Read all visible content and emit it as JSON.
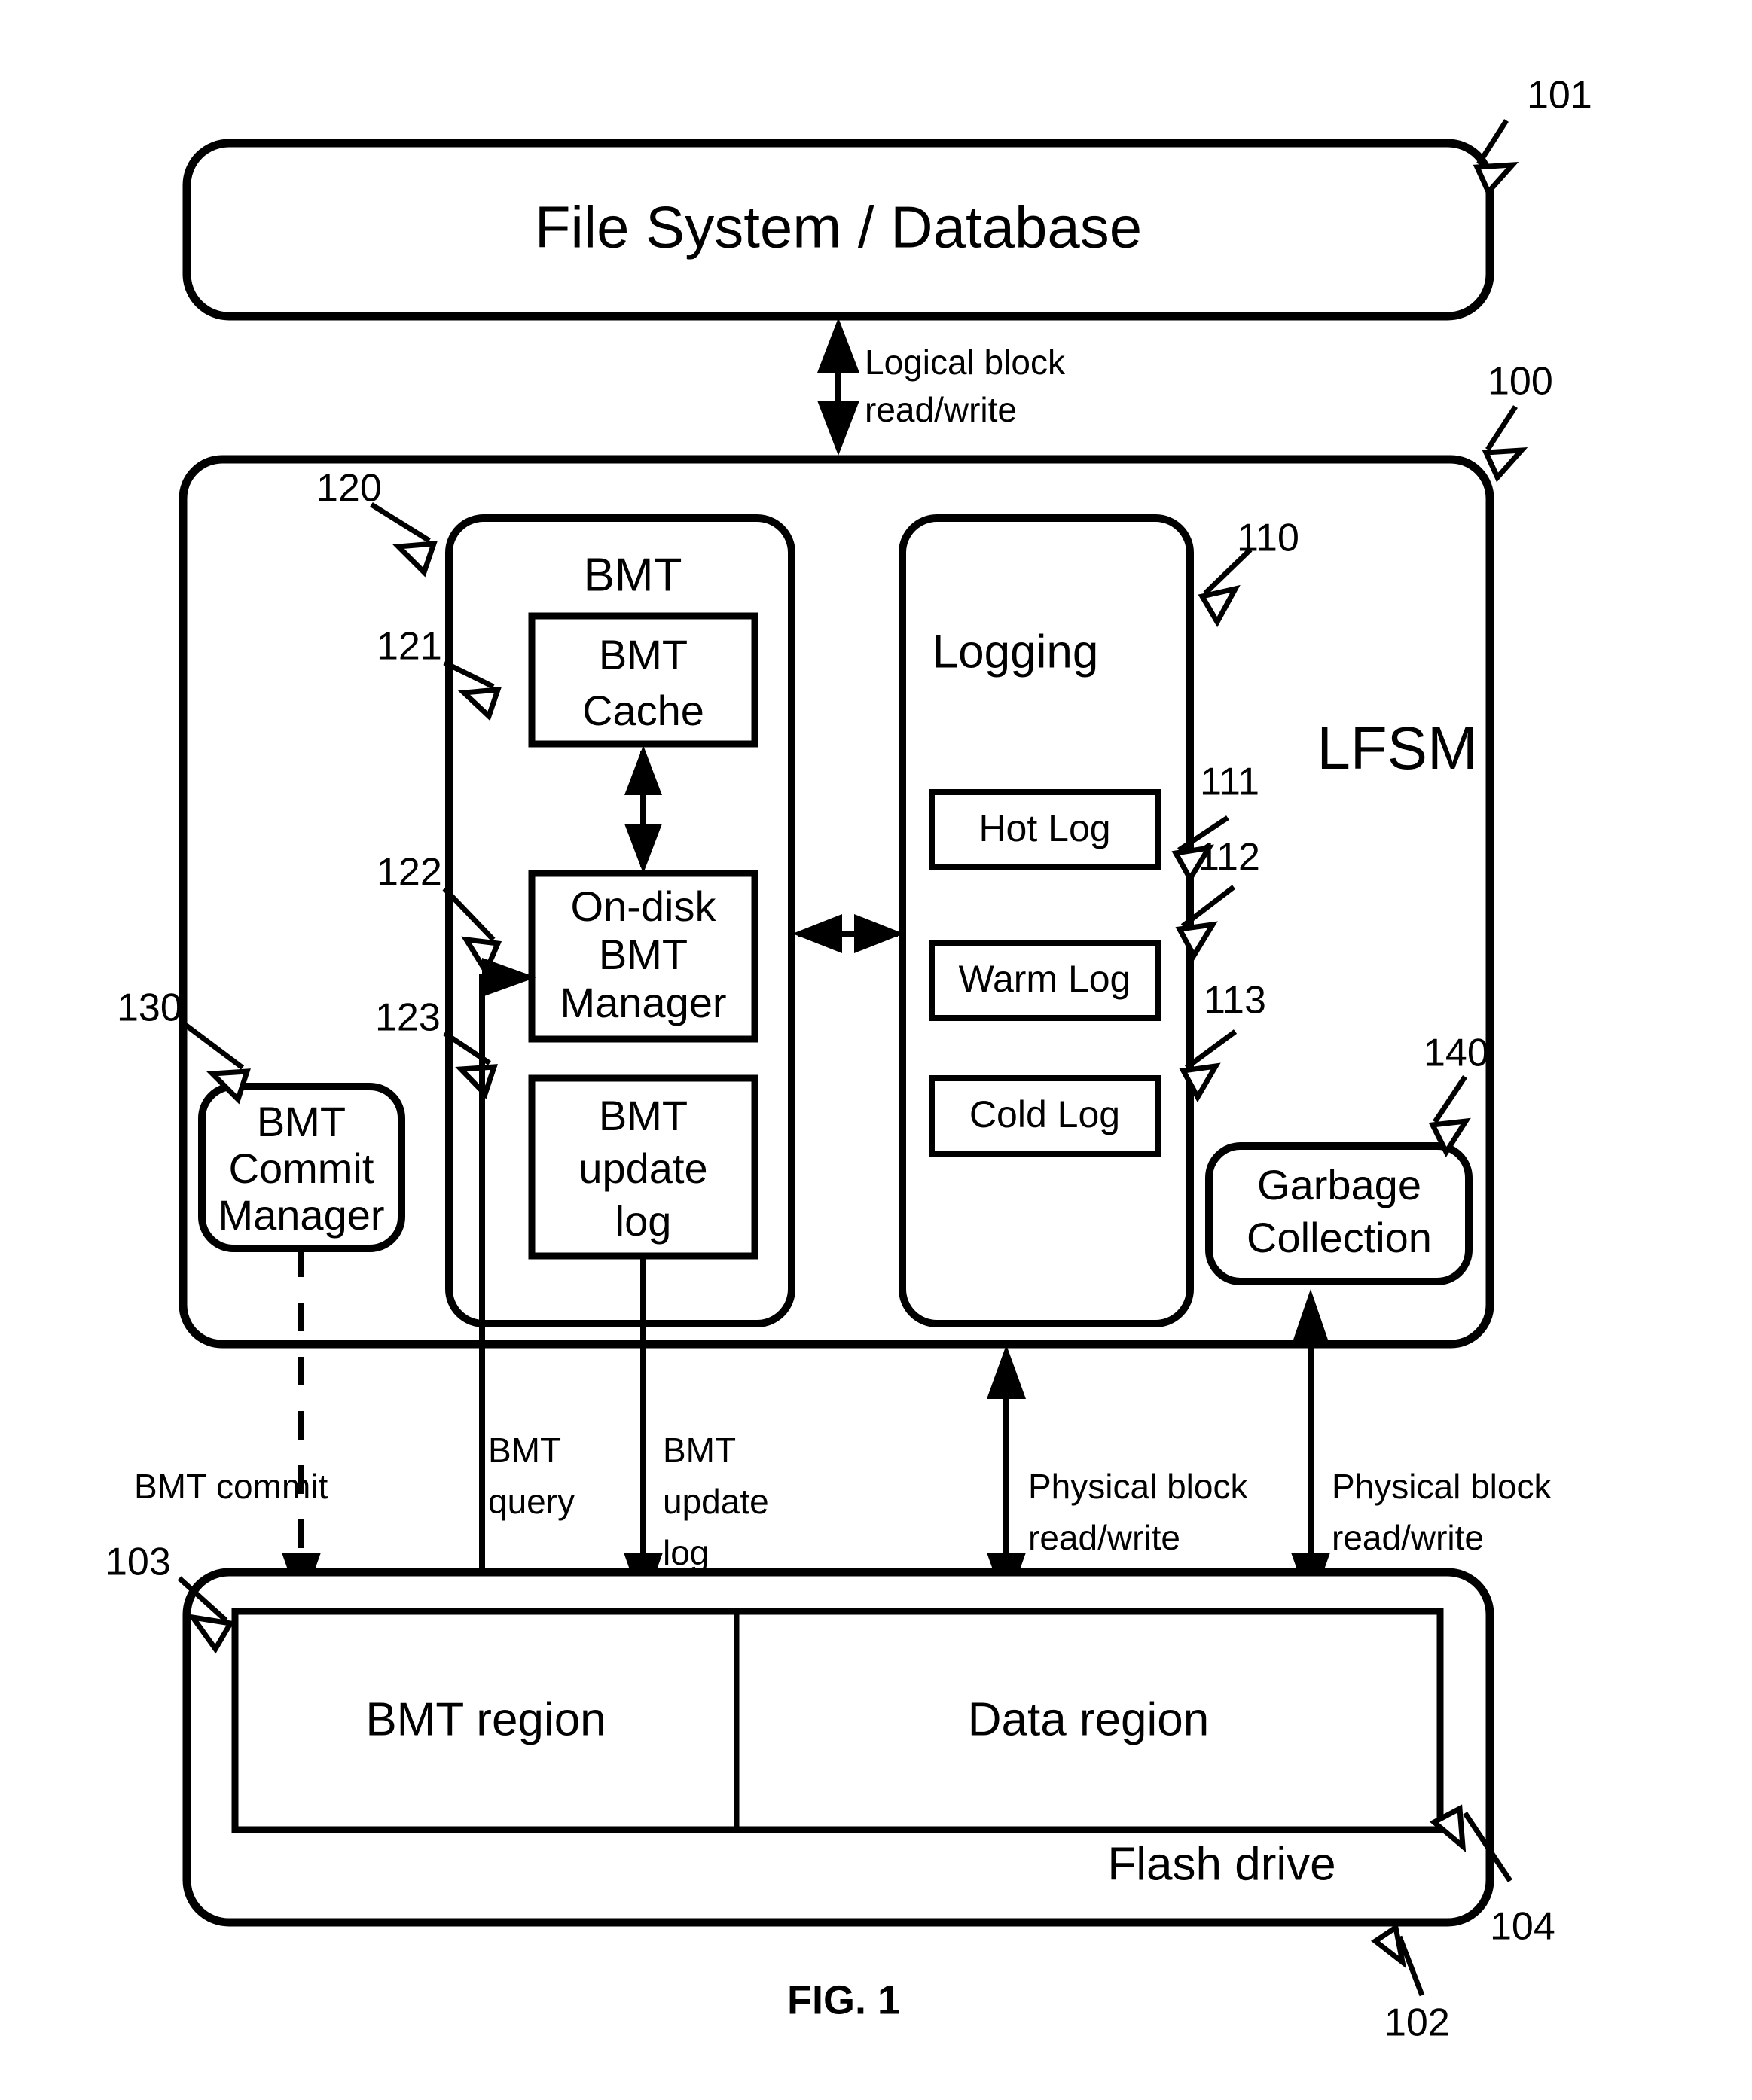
{
  "figure": {
    "caption": "FIG. 1"
  },
  "top_block": {
    "label": "File System / Database",
    "ref": "101"
  },
  "interface_labels": {
    "logical": "Logical block\nread/write",
    "logical_line1": "Logical block",
    "logical_line2": "read/write",
    "bmt_commit": "BMT commit",
    "bmt_query_line1": "BMT",
    "bmt_query_line2": "query",
    "bmt_update_line1": "BMT",
    "bmt_update_line2": "update",
    "bmt_update_line3": "log",
    "physical_a_line1": "Physical block",
    "physical_a_line2": "read/write",
    "physical_b_line1": "Physical block",
    "physical_b_line2": "read/write"
  },
  "lfsm": {
    "label": "LFSM",
    "ref": "100",
    "bmt_group": {
      "label": "BMT",
      "ref": "120",
      "items": [
        {
          "label_line1": "BMT",
          "label_line2": "Cache",
          "label_line3": "",
          "ref": "121"
        },
        {
          "label_line1": "On-disk",
          "label_line2": "BMT",
          "label_line3": "Manager",
          "ref": "122"
        },
        {
          "label_line1": "BMT",
          "label_line2": "update",
          "label_line3": "log",
          "ref": "123"
        }
      ]
    },
    "logging_group": {
      "label": "Logging",
      "ref": "110",
      "items": [
        {
          "label": "Hot Log",
          "ref": "111"
        },
        {
          "label": "Warm Log",
          "ref": "112"
        },
        {
          "label": "Cold Log",
          "ref": "113"
        }
      ]
    },
    "commit_manager": {
      "label_line1": "BMT",
      "label_line2": "Commit",
      "label_line3": "Manager",
      "ref": "130"
    },
    "garbage_collection": {
      "label_line1": "Garbage",
      "label_line2": "Collection",
      "ref": "140"
    }
  },
  "flash_drive": {
    "label": "Flash drive",
    "ref": "102",
    "regions": [
      {
        "label": "BMT region",
        "ref": "103"
      },
      {
        "label": "Data region",
        "ref": "104"
      }
    ]
  },
  "colors": {
    "stroke": "#000000",
    "fill": "#ffffff"
  }
}
